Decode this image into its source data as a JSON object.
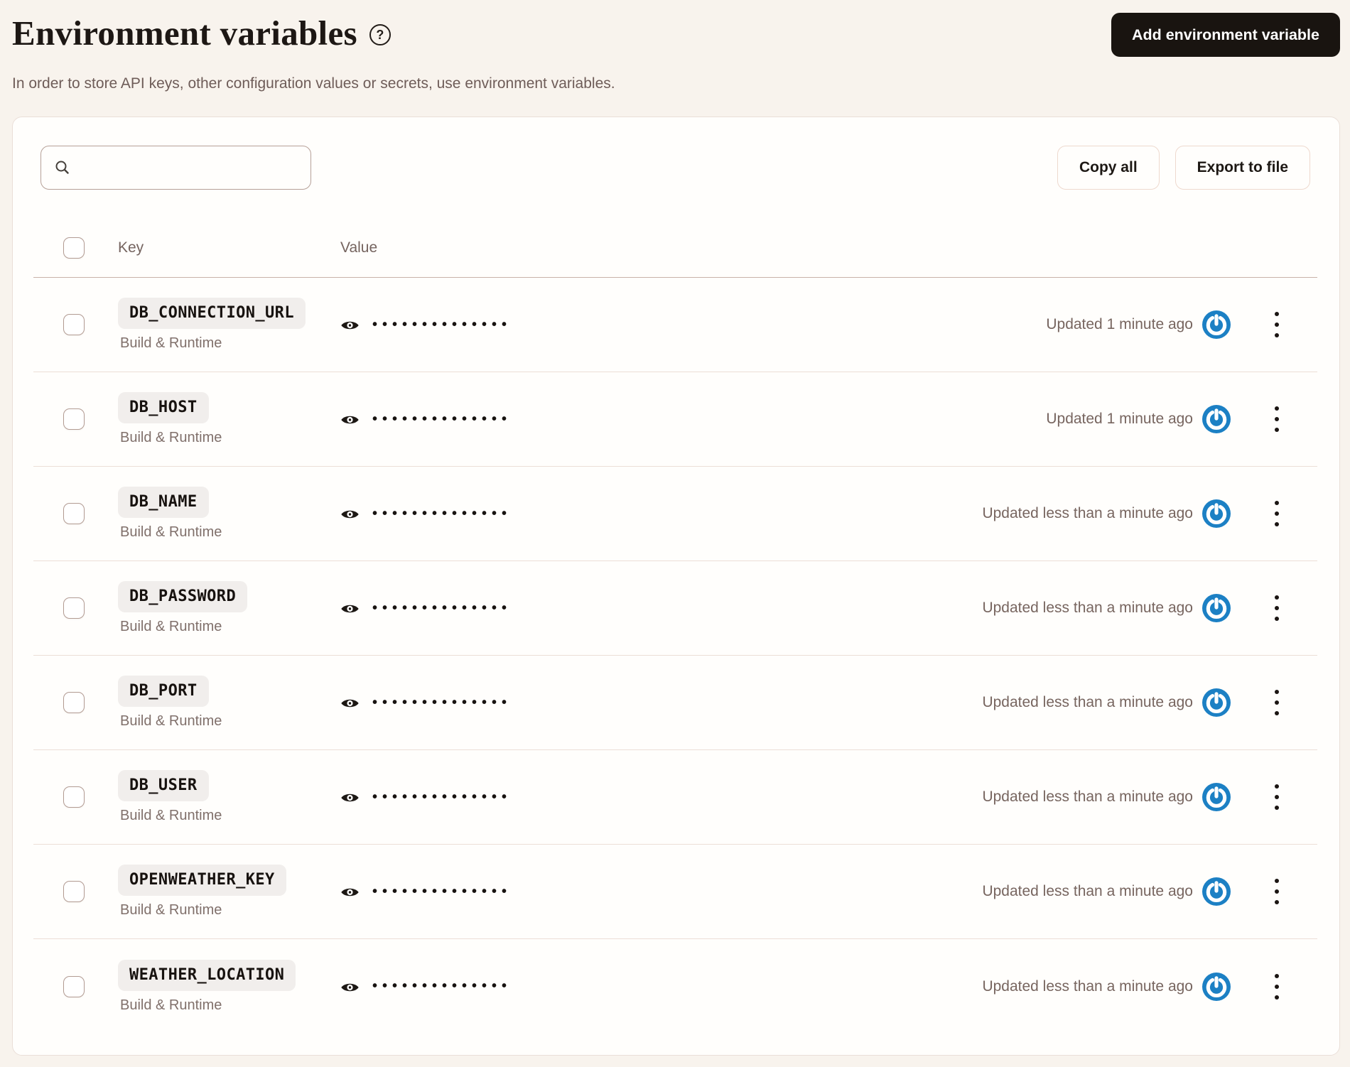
{
  "page": {
    "title": "Environment variables",
    "help_glyph": "?",
    "subtitle": "In order to store API keys, other configuration values or secrets, use environment variables.",
    "add_button_label": "Add environment variable"
  },
  "toolbar": {
    "search_placeholder": "",
    "search_value": "",
    "copy_all_label": "Copy all",
    "export_label": "Export to file"
  },
  "table": {
    "columns": {
      "key": "Key",
      "value": "Value"
    },
    "masked_value": "••••••••••••••",
    "rows": [
      {
        "key": "DB_CONNECTION_URL",
        "scope": "Build & Runtime",
        "updated": "Updated 1 minute ago"
      },
      {
        "key": "DB_HOST",
        "scope": "Build & Runtime",
        "updated": "Updated 1 minute ago"
      },
      {
        "key": "DB_NAME",
        "scope": "Build & Runtime",
        "updated": "Updated less than a minute ago"
      },
      {
        "key": "DB_PASSWORD",
        "scope": "Build & Runtime",
        "updated": "Updated less than a minute ago"
      },
      {
        "key": "DB_PORT",
        "scope": "Build & Runtime",
        "updated": "Updated less than a minute ago"
      },
      {
        "key": "DB_USER",
        "scope": "Build & Runtime",
        "updated": "Updated less than a minute ago"
      },
      {
        "key": "OPENWEATHER_KEY",
        "scope": "Build & Runtime",
        "updated": "Updated less than a minute ago"
      },
      {
        "key": "WEATHER_LOCATION",
        "scope": "Build & Runtime",
        "updated": "Updated less than a minute ago"
      }
    ]
  },
  "icons": {
    "help": "question-mark-circle",
    "search": "magnifier",
    "reveal": "eye",
    "status": "power-sync-circle",
    "row_menu": "kebab-vertical-dots"
  },
  "colors": {
    "page_background": "#f8f3ed",
    "card_background": "#fffefc",
    "primary_button": "#191410",
    "status_icon_blue": "#1c80c4",
    "header_divider": "#c9b2a9",
    "row_divider": "#ecdfd7",
    "muted_text": "#77655f"
  }
}
